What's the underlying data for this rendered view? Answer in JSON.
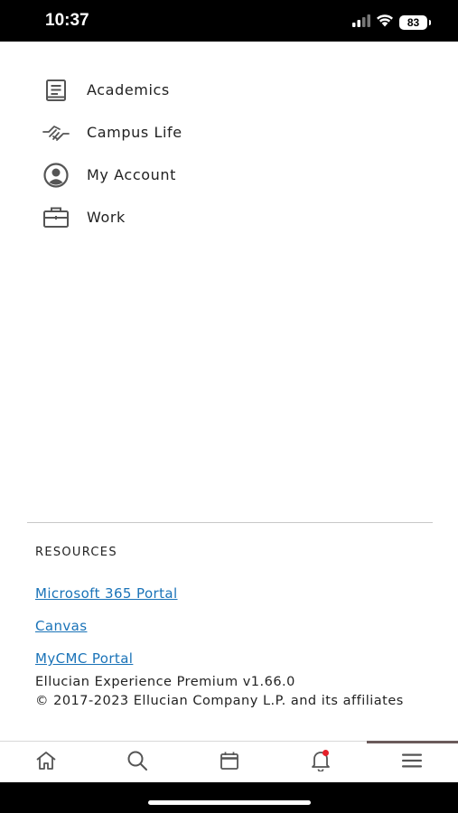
{
  "status": {
    "time": "10:37",
    "battery": "83",
    "icons": [
      "cellular-signal-icon",
      "wifi-icon",
      "battery-icon"
    ]
  },
  "menu": {
    "items": [
      {
        "label": "Academics",
        "icon": "book-icon"
      },
      {
        "label": "Campus Life",
        "icon": "handshake-icon"
      },
      {
        "label": "My Account",
        "icon": "account-circle-icon"
      },
      {
        "label": "Work",
        "icon": "briefcase-icon"
      }
    ]
  },
  "resources": {
    "heading": "RESOURCES",
    "links": [
      {
        "label": "Microsoft 365 Portal"
      },
      {
        "label": "Canvas"
      },
      {
        "label": "MyCMC Portal"
      }
    ],
    "version": "Ellucian Experience Premium v1.66.0",
    "copyright": "© 2017-2023 Ellucian Company L.P. and its affiliates"
  },
  "tabbar": {
    "tabs": [
      {
        "name": "home",
        "icon": "home-icon"
      },
      {
        "name": "search",
        "icon": "search-icon"
      },
      {
        "name": "calendar",
        "icon": "calendar-icon"
      },
      {
        "name": "notifications",
        "icon": "bell-icon"
      },
      {
        "name": "menu",
        "icon": "hamburger-menu-icon",
        "active": true
      }
    ]
  },
  "colors": {
    "link": "#1a73b8",
    "active_tab_indicator": "#6b5b5b",
    "notification_dot": "#e4202a",
    "icon_gray": "#555555"
  }
}
